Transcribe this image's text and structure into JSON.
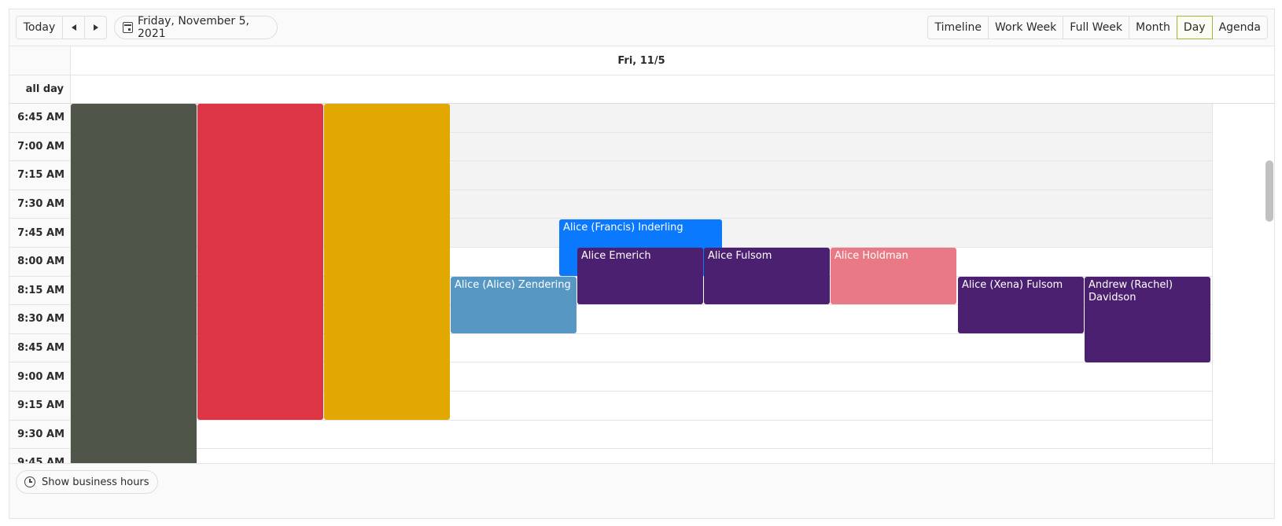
{
  "toolbar": {
    "today_label": "Today",
    "prev_icon": "triangle-left",
    "next_icon": "triangle-right",
    "date_label": "Friday, November 5, 2021",
    "date_icon": "calendar-icon",
    "views": [
      {
        "label": "Timeline",
        "active": false
      },
      {
        "label": "Work Week",
        "active": false
      },
      {
        "label": "Full Week",
        "active": false
      },
      {
        "label": "Month",
        "active": false
      },
      {
        "label": "Day",
        "active": true
      },
      {
        "label": "Agenda",
        "active": false
      }
    ]
  },
  "header": {
    "day_label": "Fri, 11/5"
  },
  "allday": {
    "label": "all day"
  },
  "times": [
    "6:45 AM",
    "7:00 AM",
    "7:15 AM",
    "7:30 AM",
    "7:45 AM",
    "8:00 AM",
    "8:15 AM",
    "8:30 AM",
    "8:45 AM",
    "9:00 AM",
    "9:15 AM",
    "9:30 AM",
    "9:45 AM"
  ],
  "events": [
    {
      "title": "",
      "color": "#50554a"
    },
    {
      "title": "",
      "color": "#dc3545"
    },
    {
      "title": "",
      "color": "#e0a800"
    },
    {
      "title": "Alice (Alice) Zendering",
      "color": "#5797c4"
    },
    {
      "title": "Alice (Francis) Inderling",
      "color": "#0a79fd"
    },
    {
      "title": "Alice Emerich",
      "color": "#4c2070"
    },
    {
      "title": "Alice Fulsom",
      "color": "#4c2070"
    },
    {
      "title": "Alice Holdman",
      "color": "#e97a85"
    },
    {
      "title": "Alice (Xena) Fulsom",
      "color": "#4c2070"
    },
    {
      "title": "Andrew (Rachel) Davidson",
      "color": "#4c2070"
    }
  ],
  "footer": {
    "business_hours_label": "Show business hours",
    "icon": "clock-icon"
  }
}
